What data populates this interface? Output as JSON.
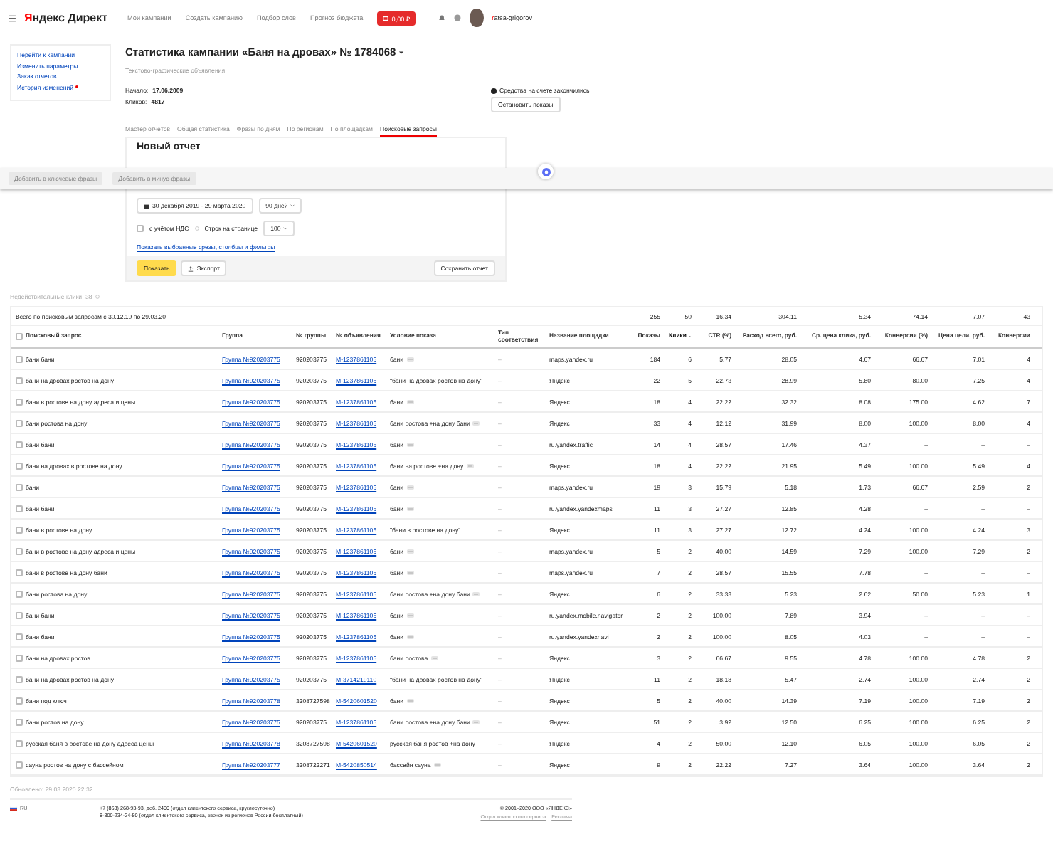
{
  "header": {
    "logo": {
      "first": "Я",
      "rest": "ндекс Директ"
    },
    "nav": [
      "Мои кампании",
      "Создать кампанию",
      "Подбор слов",
      "Прогноз бюджета"
    ],
    "balance": "0,00 ₽",
    "user": "ratsa-grigorov"
  },
  "sidebar": {
    "links": [
      {
        "label": "Перейти к кампании",
        "new": false
      },
      {
        "label": "Изменить параметры",
        "new": false
      },
      {
        "label": "Заказ отчетов",
        "new": false
      },
      {
        "label": "История изменений",
        "new": true
      }
    ]
  },
  "campaign": {
    "title_prefix": "Статистика кампании",
    "name": "«Баня на дровах» № 1784068",
    "type": "Текстово-графические объявления",
    "facts": [
      {
        "label": "Начало:",
        "value": "17.06.2009"
      },
      {
        "label": "Кликов:",
        "value": "4817"
      }
    ],
    "notice": "Средства на счете закончились",
    "stop_button": "Остановить показы"
  },
  "tabs": [
    {
      "label": "Мастер отчётов",
      "selected": false
    },
    {
      "label": "Общая статистика",
      "selected": false
    },
    {
      "label": "Фразы по дням",
      "selected": false
    },
    {
      "label": "По регионам",
      "selected": false
    },
    {
      "label": "По площадкам",
      "selected": false
    },
    {
      "label": "Поисковые запросы",
      "selected": true
    }
  ],
  "report": {
    "title": "Новый отчет",
    "period": "30 декабря 2019 - 29 марта 2020",
    "range": "90 дней",
    "vat": {
      "label": "с учётом НДС",
      "checked": false
    },
    "rows_label": "Строк на странице",
    "rows_value": "100",
    "filters_link": "Показать выбранные срезы, столбцы и фильтры",
    "show_button": "Показать",
    "export_button": "Экспорт",
    "save_button": "Сохранить отчет"
  },
  "action_bar": {
    "buttons": [
      "Добавить в ключевые фразы",
      "Добавить в минус-фразы"
    ]
  },
  "invalid_clicks": "Недействительные клики: 38",
  "table": {
    "summary": "Всего по поисковым запросам с 30.12.19 по 29.03.20",
    "totals": [
      "255",
      "50",
      "16.34",
      "304.11",
      "5.34",
      "74.14",
      "7.07",
      "43"
    ],
    "all_checked": false,
    "columns": [
      {
        "label": "Поисковый запрос",
        "sorted": false
      },
      {
        "label": "Группа",
        "sorted": false
      },
      {
        "label": "№ группы",
        "sorted": false
      },
      {
        "label": "№ объявления",
        "sorted": false
      },
      {
        "label": "Условие показа",
        "sorted": false
      },
      {
        "label": "Тип соответствия",
        "sorted": false
      },
      {
        "label": "Название площадки",
        "sorted": false
      },
      {
        "label": "Показы",
        "sorted": false
      },
      {
        "label": "Клики",
        "sorted": true
      },
      {
        "label": "CTR (%)",
        "sorted": false
      },
      {
        "label": "Расход всего, руб.",
        "sorted": false
      },
      {
        "label": "Ср. цена клика, руб.",
        "sorted": false
      },
      {
        "label": "Конверсия (%)",
        "sorted": false
      },
      {
        "label": "Цена цели, руб.",
        "sorted": false
      },
      {
        "label": "Конверсии",
        "sorted": false
      }
    ],
    "rows": [
      {
        "kind": "keyword",
        "checked": false,
        "query": "бани бани",
        "group": "Группа №920203775",
        "group_no": "920203775",
        "ad_no": "M-1237861105",
        "condition": "бани",
        "match": "–",
        "site": "maps.yandex.ru",
        "stats": [
          "184",
          "6",
          "5.77",
          "28.05",
          "4.67",
          "66.67",
          "7.01",
          "4"
        ]
      },
      {
        "kind": "phrase",
        "checked": false,
        "query": "бани на дровах ростов на дону",
        "group": "Группа №920203775",
        "group_no": "920203775",
        "ad_no": "M-1237861105",
        "condition": "\"бани на дровах ростов на дону\"",
        "match": "–",
        "site": "Яндекс",
        "stats": [
          "22",
          "5",
          "22.73",
          "28.99",
          "5.80",
          "80.00",
          "7.25",
          "4"
        ]
      },
      {
        "kind": "keyword",
        "checked": false,
        "query": "бани в ростове на дону адреса и цены",
        "group": "Группа №920203775",
        "group_no": "920203775",
        "ad_no": "M-1237861105",
        "condition": "бани",
        "match": "–",
        "site": "Яндекс",
        "stats": [
          "18",
          "4",
          "22.22",
          "32.32",
          "8.08",
          "175.00",
          "4.62",
          "7"
        ]
      },
      {
        "kind": "keyword",
        "checked": false,
        "query": "бани ростова на дону",
        "group": "Группа №920203775",
        "group_no": "920203775",
        "ad_no": "M-1237861105",
        "condition": "бани ростова +на дону бани",
        "match": "–",
        "site": "Яндекс",
        "stats": [
          "33",
          "4",
          "12.12",
          "31.99",
          "8.00",
          "100.00",
          "8.00",
          "4"
        ]
      },
      {
        "kind": "keyword",
        "checked": false,
        "query": "бани бани",
        "group": "Группа №920203775",
        "group_no": "920203775",
        "ad_no": "M-1237861105",
        "condition": "бани",
        "match": "–",
        "site": "ru.yandex.traffic",
        "stats": [
          "14",
          "4",
          "28.57",
          "17.46",
          "4.37",
          "–",
          "–",
          "–"
        ]
      },
      {
        "kind": "keyword",
        "checked": false,
        "query": "бани на дровах в ростове на дону",
        "group": "Группа №920203775",
        "group_no": "920203775",
        "ad_no": "M-1237861105",
        "condition": "бани на ростове +на дону",
        "match": "–",
        "site": "Яндекс",
        "stats": [
          "18",
          "4",
          "22.22",
          "21.95",
          "5.49",
          "100.00",
          "5.49",
          "4"
        ]
      },
      {
        "kind": "keyword",
        "checked": false,
        "query": "бани",
        "group": "Группа №920203775",
        "group_no": "920203775",
        "ad_no": "M-1237861105",
        "condition": "бани",
        "match": "–",
        "site": "maps.yandex.ru",
        "stats": [
          "19",
          "3",
          "15.79",
          "5.18",
          "1.73",
          "66.67",
          "2.59",
          "2"
        ]
      },
      {
        "kind": "keyword",
        "checked": false,
        "query": "бани бани",
        "group": "Группа №920203775",
        "group_no": "920203775",
        "ad_no": "M-1237861105",
        "condition": "бани",
        "match": "–",
        "site": "ru.yandex.yandexmaps",
        "stats": [
          "11",
          "3",
          "27.27",
          "12.85",
          "4.28",
          "–",
          "–",
          "–"
        ]
      },
      {
        "kind": "phrase",
        "checked": false,
        "query": "бани в ростове на дону",
        "group": "Группа №920203775",
        "group_no": "920203775",
        "ad_no": "M-1237861105",
        "condition": "\"бани в ростове на дону\"",
        "match": "–",
        "site": "Яндекс",
        "stats": [
          "11",
          "3",
          "27.27",
          "12.72",
          "4.24",
          "100.00",
          "4.24",
          "3"
        ]
      },
      {
        "kind": "keyword",
        "checked": false,
        "query": "бани в ростове на дону адреса и цены",
        "group": "Группа №920203775",
        "group_no": "920203775",
        "ad_no": "M-1237861105",
        "condition": "бани",
        "match": "–",
        "site": "maps.yandex.ru",
        "stats": [
          "5",
          "2",
          "40.00",
          "14.59",
          "7.29",
          "100.00",
          "7.29",
          "2"
        ]
      },
      {
        "kind": "keyword",
        "checked": false,
        "query": "бани в ростове на дону бани",
        "group": "Группа №920203775",
        "group_no": "920203775",
        "ad_no": "M-1237861105",
        "condition": "бани",
        "match": "–",
        "site": "maps.yandex.ru",
        "stats": [
          "7",
          "2",
          "28.57",
          "15.55",
          "7.78",
          "–",
          "–",
          "–"
        ]
      },
      {
        "kind": "keyword",
        "checked": false,
        "query": "бани ростова на дону",
        "group": "Группа №920203775",
        "group_no": "920203775",
        "ad_no": "M-1237861105",
        "condition": "бани ростова +на дону бани",
        "match": "–",
        "site": "Яндекс",
        "stats": [
          "6",
          "2",
          "33.33",
          "5.23",
          "2.62",
          "50.00",
          "5.23",
          "1"
        ]
      },
      {
        "kind": "keyword",
        "checked": false,
        "query": "бани бани",
        "group": "Группа №920203775",
        "group_no": "920203775",
        "ad_no": "M-1237861105",
        "condition": "бани",
        "match": "–",
        "site": "ru.yandex.mobile.navigator",
        "stats": [
          "2",
          "2",
          "100.00",
          "7.89",
          "3.94",
          "–",
          "–",
          "–"
        ]
      },
      {
        "kind": "keyword",
        "checked": false,
        "query": "бани бани",
        "group": "Группа №920203775",
        "group_no": "920203775",
        "ad_no": "M-1237861105",
        "condition": "бани",
        "match": "–",
        "site": "ru.yandex.yandexnavi",
        "stats": [
          "2",
          "2",
          "100.00",
          "8.05",
          "4.03",
          "–",
          "–",
          "–"
        ]
      },
      {
        "kind": "keyword",
        "checked": false,
        "query": "бани на дровах ростов",
        "group": "Группа №920203775",
        "group_no": "920203775",
        "ad_no": "M-1237861105",
        "condition": "бани ростова",
        "match": "–",
        "site": "Яндекс",
        "stats": [
          "3",
          "2",
          "66.67",
          "9.55",
          "4.78",
          "100.00",
          "4.78",
          "2"
        ]
      },
      {
        "kind": "phrase",
        "checked": false,
        "query": "бани на дровах ростов на дону",
        "group": "Группа №920203775",
        "group_no": "920203775",
        "ad_no": "M-3714219110",
        "condition": "\"бани на дровах ростов на дону\"",
        "match": "–",
        "site": "Яндекс",
        "stats": [
          "11",
          "2",
          "18.18",
          "5.47",
          "2.74",
          "100.00",
          "2.74",
          "2"
        ]
      },
      {
        "kind": "keyword",
        "checked": false,
        "query": "бани под ключ",
        "group": "Группа №920203778",
        "group_no": "3208727598",
        "ad_no": "M-5420601520",
        "condition": "бани",
        "match": "–",
        "site": "Яндекс",
        "stats": [
          "5",
          "2",
          "40.00",
          "14.39",
          "7.19",
          "100.00",
          "7.19",
          "2"
        ]
      },
      {
        "kind": "keyword",
        "checked": false,
        "query": "бани ростов на дону",
        "group": "Группа №920203775",
        "group_no": "920203775",
        "ad_no": "M-1237861105",
        "condition": "бани ростова +на дону бани",
        "match": "–",
        "site": "Яндекс",
        "stats": [
          "51",
          "2",
          "3.92",
          "12.50",
          "6.25",
          "100.00",
          "6.25",
          "2"
        ]
      },
      {
        "kind": "phrase",
        "checked": false,
        "query": "русская баня в ростове на дону адреса цены",
        "group": "Группа №920203778",
        "group_no": "3208727598",
        "ad_no": "M-5420601520",
        "condition": "русская баня ростов +на дону",
        "match": "–",
        "site": "Яндекс",
        "stats": [
          "4",
          "2",
          "50.00",
          "12.10",
          "6.05",
          "100.00",
          "6.05",
          "2"
        ]
      },
      {
        "kind": "keyword",
        "checked": false,
        "query": "сауна ростов на дону с бассейном",
        "group": "Группа №920203777",
        "group_no": "3208722271",
        "ad_no": "M-5420850514",
        "condition": "бассейн сауна",
        "match": "–",
        "site": "Яндекс",
        "stats": [
          "9",
          "2",
          "22.22",
          "7.27",
          "3.64",
          "100.00",
          "3.64",
          "2"
        ]
      }
    ]
  },
  "updated": "Обновлено: 29.03.2020 22:32",
  "footer": {
    "lang": "RU",
    "phones": [
      "+7 (863) 268-93-93, доб. 2400 (отдел клиентского сервиса, круглосуточно)",
      "8-800-234-24-80 (отдел клиентского сервиса, звонок из регионов России бесплатный)"
    ],
    "copyright": "© 2001–2020 ООО «ЯНДЕКС»",
    "links": [
      "Отдел клиентского сервиса",
      "Реклама"
    ]
  }
}
